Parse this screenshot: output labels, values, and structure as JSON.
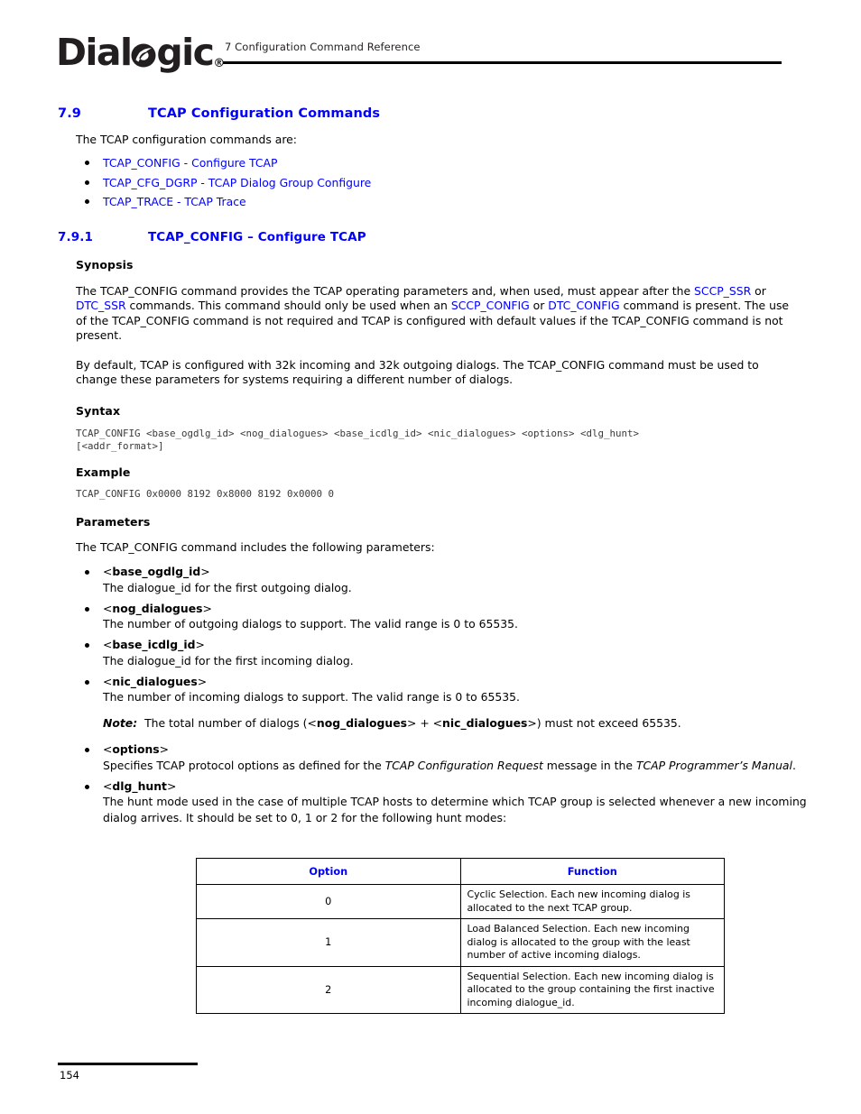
{
  "header": {
    "logo_text_1": "Dial",
    "logo_icon": "dialogic-o-leaf-logo",
    "logo_text_2": "gic",
    "logo_registered": "®",
    "chapter_title": "7 Configuration Command Reference"
  },
  "section": {
    "number": "7.9",
    "title": "TCAP Configuration Commands",
    "intro": "The TCAP configuration commands are:",
    "links": [
      {
        "command": "TCAP_CONFIG",
        "separator": " - ",
        "description": "Configure TCAP"
      },
      {
        "command": "TCAP_CFG_DGRP",
        "separator": " - ",
        "description": "TCAP Dialog Group Configure"
      },
      {
        "command": "TCAP_TRACE",
        "separator": " - ",
        "description": "TCAP Trace"
      }
    ]
  },
  "subsection": {
    "number": "7.9.1",
    "title": "TCAP_CONFIG – Configure TCAP"
  },
  "synopsis": {
    "heading": "Synopsis",
    "p1_a": "The TCAP_CONFIG command provides the TCAP operating parameters and, when used, must appear after the ",
    "p1_link1": "SCCP_SSR",
    "p1_b": " or ",
    "p1_link2": "DTC_SSR",
    "p1_c": " commands. This command should only be used when an ",
    "p1_link3": "SCCP_CONFIG",
    "p1_d": " or ",
    "p1_link4": "DTC_CONFIG",
    "p1_e": " command is present. The use of the TCAP_CONFIG command is not required and TCAP is configured with default values if the TCAP_CONFIG command is not present.",
    "p2": "By default, TCAP is configured with 32k incoming and 32k outgoing dialogs. The TCAP_CONFIG command must be used to change these parameters for systems requiring a different number of dialogs."
  },
  "syntax": {
    "heading": "Syntax",
    "code": "TCAP_CONFIG <base_ogdlg_id> <nog_dialogues> <base_icdlg_id> <nic_dialogues> <options> <dlg_hunt>\n[<addr_format>]"
  },
  "example": {
    "heading": "Example",
    "code": "TCAP_CONFIG 0x0000 8192 0x8000 8192 0x0000 0"
  },
  "parameters": {
    "heading": "Parameters",
    "intro": "The TCAP_CONFIG command includes the following parameters:",
    "items": [
      {
        "name": "base_ogdlg_id",
        "description": "The dialogue_id for the first outgoing dialog."
      },
      {
        "name": "nog_dialogues",
        "description": "The number of outgoing dialogs to support. The valid range is 0 to 65535."
      },
      {
        "name": "base_icdlg_id",
        "description": "The dialogue_id for the first incoming dialog."
      },
      {
        "name": "nic_dialogues",
        "description": "The number of incoming dialogs to support. The valid range is 0 to 65535."
      }
    ],
    "note": {
      "label": "Note:",
      "text_a": "The total number of dialogs (<",
      "bold1": "nog_dialogues",
      "text_b": "> + <",
      "bold2": "nic_dialogues",
      "text_c": ">) must not exceed 65535."
    },
    "options_item": {
      "name": "options",
      "desc_a": "Specifies TCAP protocol options as defined for the ",
      "desc_italic1": "TCAP Configuration Request",
      "desc_b": " message in the ",
      "desc_italic2": "TCAP Programmer’s Manual",
      "desc_c": "."
    },
    "dlg_hunt_item": {
      "name": "dlg_hunt",
      "description": "The hunt mode used in the case of multiple TCAP hosts to determine which TCAP group is selected whenever a new incoming dialog arrives. It should be set to 0, 1 or 2 for the following hunt modes:"
    }
  },
  "table": {
    "headers": [
      "Option",
      "Function"
    ],
    "rows": [
      {
        "option": "0",
        "function": "Cyclic Selection. Each new incoming dialog is allocated to the next TCAP group."
      },
      {
        "option": "1",
        "function": "Load Balanced Selection. Each new incoming dialog is allocated to the group with the least number of active incoming dialogs."
      },
      {
        "option": "2",
        "function": "Sequential Selection. Each new incoming dialog is allocated to the group containing the first inactive incoming dialogue_id."
      }
    ]
  },
  "footer": {
    "page_number": "154"
  },
  "colors": {
    "link_blue": "#0000ff",
    "text_black": "#000000",
    "logo_dark": "#231f20"
  }
}
